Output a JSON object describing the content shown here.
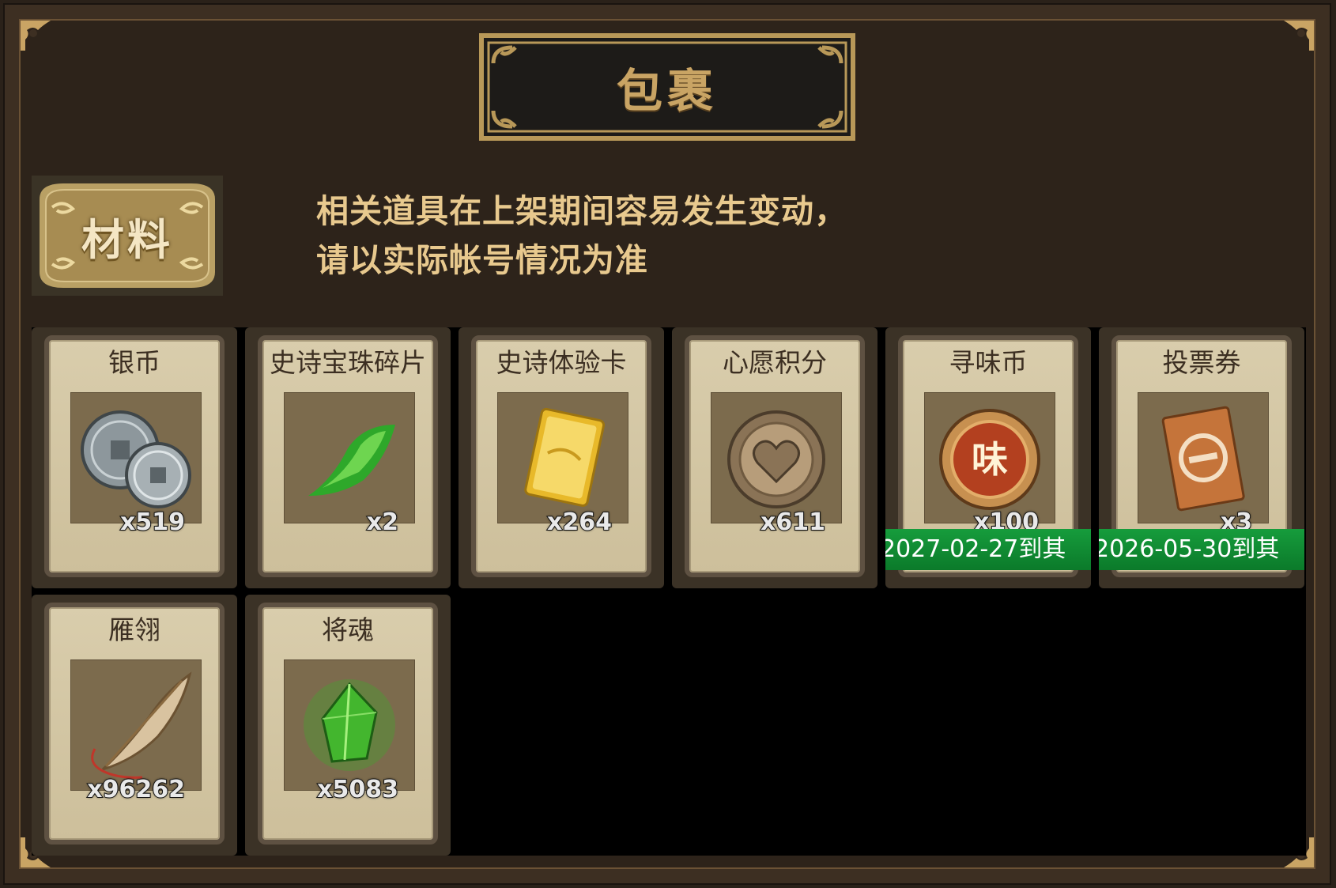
{
  "window": {
    "title": "包裹"
  },
  "category": {
    "label": "材料"
  },
  "notice": {
    "line1": "相关道具在上架期间容易发生变动，",
    "line2": "请以实际帐号情况为准"
  },
  "items": [
    {
      "name": "银币",
      "count": "x519",
      "icon": "silver-coin-icon",
      "expiry": ""
    },
    {
      "name": "史诗宝珠碎片",
      "count": "x2",
      "icon": "green-shard-icon",
      "expiry": ""
    },
    {
      "name": "史诗体验卡",
      "count": "x264",
      "icon": "gold-card-icon",
      "expiry": ""
    },
    {
      "name": "心愿积分",
      "count": "x611",
      "icon": "heart-coin-icon",
      "expiry": ""
    },
    {
      "name": "寻味币",
      "count": "x100",
      "icon": "flavor-coin-icon",
      "expiry": "2027-02-27到其"
    },
    {
      "name": "投票券",
      "count": "x3",
      "icon": "vote-ticket-icon",
      "expiry": "2026-05-30到其"
    },
    {
      "name": "雁翎",
      "count": "x96262",
      "icon": "feather-icon",
      "expiry": ""
    },
    {
      "name": "将魂",
      "count": "x5083",
      "icon": "green-crystal-icon",
      "expiry": ""
    }
  ],
  "colors": {
    "frame": "#3d2f22",
    "title_gold": "#c9a464",
    "card_bg": "#d9cdac",
    "expiry_green": "#169c3c"
  }
}
